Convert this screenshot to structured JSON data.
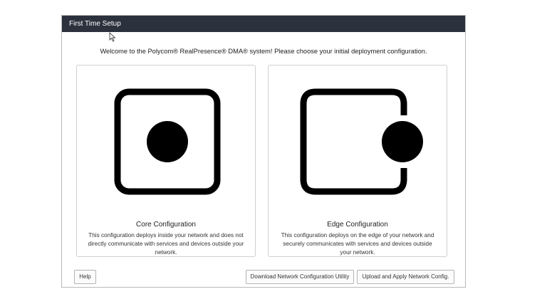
{
  "dialog": {
    "title": "First Time Setup",
    "welcome_text": "Welcome to the Polycom® RealPresence® DMA® system! Please choose your initial deployment configuration."
  },
  "options": [
    {
      "title": "Core Configuration",
      "description": "This configuration deploys inside your network and does not directly communicate with services and devices outside your network.",
      "icon": "core-configuration-icon"
    },
    {
      "title": "Edge Configuration",
      "description": "This configuration deploys on the edge of your network and securely communicates with services and devices outside your network.",
      "icon": "edge-configuration-icon"
    }
  ],
  "footer": {
    "help_label": "Help",
    "download_label": "Download Network Configuration Utility",
    "upload_label": "Upload and Apply Network Config."
  },
  "colors": {
    "titlebar": "#2b313d",
    "icon": "#000000"
  }
}
